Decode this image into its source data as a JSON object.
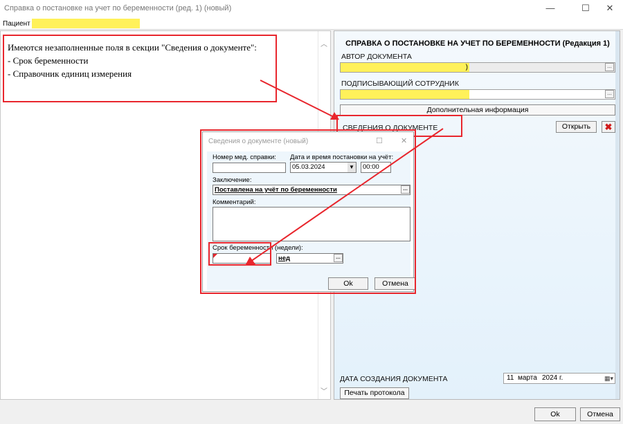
{
  "window": {
    "title": "Справка о постановке на учет по беременности (ред. 1) (новый)",
    "minimize": "—",
    "maximize": "☐",
    "close": "✕"
  },
  "patient": {
    "label": "Пациент"
  },
  "validation": {
    "heading": "Имеются незаполненные поля в секции \"Сведения о документе\":",
    "items": [
      "- Срок беременности",
      "- Справочник единиц измерения"
    ]
  },
  "document": {
    "title": "СПРАВКА О ПОСТАНОВКЕ НА УЧЕТ ПО БЕРЕМЕННОСТИ (Редакция 1)",
    "author_label": "АВТОР ДОКУМЕНТА",
    "author_value_tail": ")",
    "signer_label": "ПОДПИСЫВАЮЩИЙ СОТРУДНИК",
    "dots": "...",
    "additional_info": "Дополнительная информация",
    "section_label": "СВЕДЕНИЯ О ДОКУМЕНТЕ",
    "open_button": "Открыть",
    "creation_label": "ДАТА СОЗДАНИЯ ДОКУМЕНТА",
    "creation_day": "11",
    "creation_month": "марта",
    "creation_year": "2024 г.",
    "print_button": "Печать протокола"
  },
  "dialog": {
    "title": "Сведения о документе (новый)",
    "maximize": "☐",
    "close": "✕",
    "cert_number_label": "Номер мед. справки:",
    "cert_number_value": "",
    "datetime_label": "Дата и время постановки на учёт:",
    "date_value": "05.03.2024",
    "time_value": "00:00",
    "conclusion_label": "Заключение:",
    "conclusion_value": "Поставлена на учёт по беременности",
    "comment_label": "Комментарий:",
    "comment_value": "",
    "term_label": "Срок беременности (недели):",
    "term_value": "",
    "unit_value": "нед",
    "ok": "Ok",
    "cancel": "Отмена"
  },
  "footer": {
    "ok": "Ok",
    "cancel": "Отмена"
  },
  "colors": {
    "highlight": "#fff15a",
    "annotation": "#e8262d",
    "panel_bg": "#e3f1fb"
  }
}
